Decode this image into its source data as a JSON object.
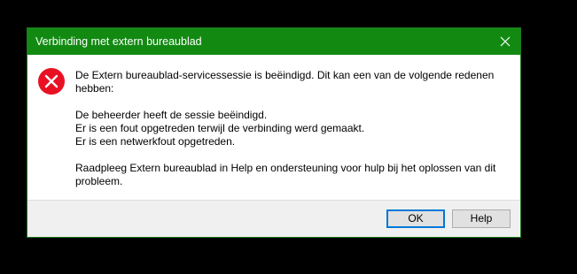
{
  "window": {
    "title": "Verbinding met extern bureaublad",
    "close_icon": "close-icon"
  },
  "message": {
    "icon": "error-icon",
    "line1": "De Extern bureaublad-servicessessie is beëindigd. Dit kan een van de volgende redenen",
    "line2": "hebben:",
    "reason1": "De beheerder heeft de sessie beëindigd.",
    "reason2": "Er is een fout opgetreden terwijl de verbinding werd gemaakt.",
    "reason3": "Er is een netwerkfout opgetreden.",
    "help_line1": "Raadpleeg Extern bureaublad in Help en ondersteuning voor hulp bij het oplossen van dit",
    "help_line2": "probleem."
  },
  "buttons": {
    "ok_label": "OK",
    "help_label": "Help"
  },
  "colors": {
    "titlebar": "#128a12",
    "error_icon": "#e81123",
    "default_button_border": "#0078d7"
  }
}
